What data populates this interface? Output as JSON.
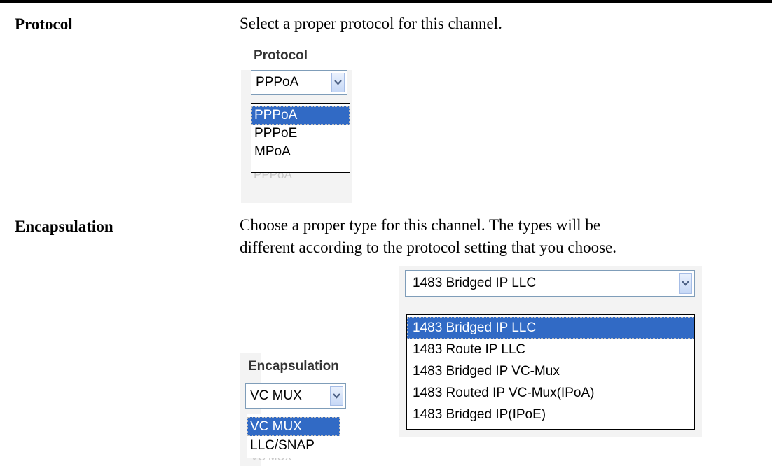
{
  "rows": [
    {
      "term": "Protocol",
      "description": "Select a proper protocol for this channel.",
      "ui": {
        "label": "Protocol",
        "selected": "PPPoA",
        "options": [
          "PPPoA",
          "PPPoE",
          "MPoA"
        ],
        "highlighted": "PPPoA"
      }
    },
    {
      "term": "Encapsulation",
      "description_lines": [
        "Choose a proper type for this channel. The types will be",
        "different according to the protocol setting that you choose."
      ],
      "ui_left": {
        "label": "Encapsulation",
        "selected": "VC MUX",
        "options": [
          "VC MUX",
          "LLC/SNAP"
        ],
        "highlighted": "VC MUX"
      },
      "ui_right": {
        "selected": "1483 Bridged IP LLC",
        "options": [
          "1483 Bridged IP LLC",
          "1483 Route IP LLC",
          "1483 Bridged IP VC-Mux",
          "1483 Routed IP VC-Mux(IPoA)",
          "1483 Bridged IP(IPoE)"
        ],
        "highlighted": "1483 Bridged IP LLC"
      }
    }
  ],
  "icons": {
    "dropdown_arrow": "chevron-down-icon"
  },
  "colors": {
    "highlight": "#316ac5",
    "select_border": "#7f9db9"
  }
}
